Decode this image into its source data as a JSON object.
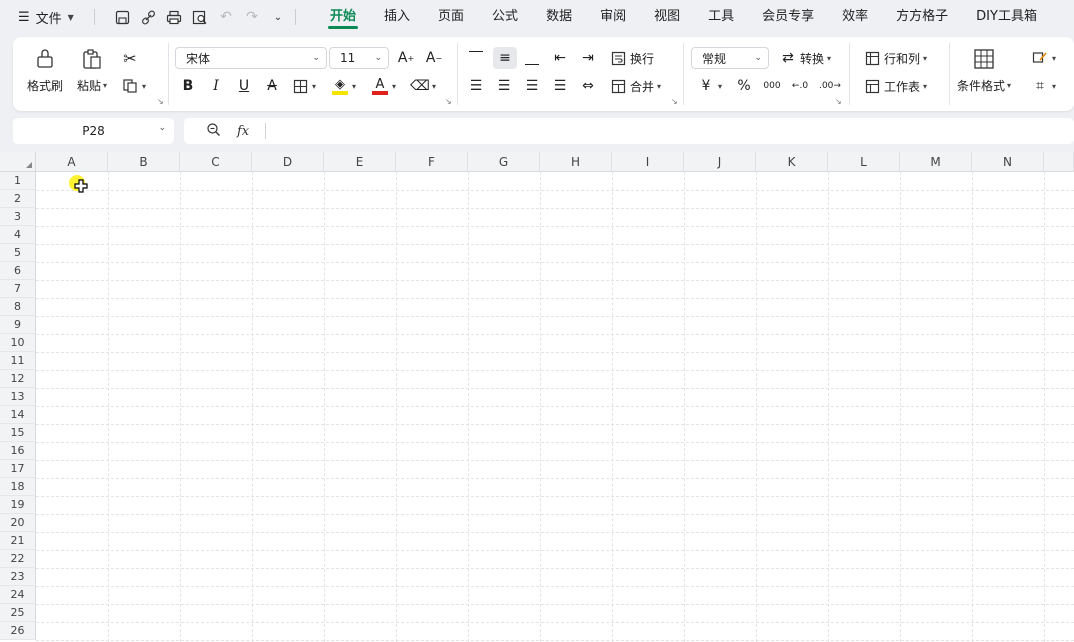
{
  "menu": {
    "file_label": "文件",
    "tabs": [
      "开始",
      "插入",
      "页面",
      "公式",
      "数据",
      "审阅",
      "视图",
      "工具",
      "会员专享",
      "效率",
      "方方格子",
      "DIY工具箱"
    ],
    "active_tab": "开始"
  },
  "ribbon": {
    "format_painter": "格式刷",
    "paste": "粘贴",
    "font_name": "宋体",
    "font_size": "11",
    "wrap": "换行",
    "merge": "合并",
    "number_format": "常规",
    "convert": "转换",
    "rows_cols": "行和列",
    "worksheet": "工作表",
    "cond_format": "条件格式",
    "currency_sym": "¥",
    "percent_sym": "%",
    "thousands_sym": "000",
    "bold": "B",
    "italic": "I",
    "underline": "U",
    "strike": "A",
    "font_color_letter": "A",
    "colors": {
      "fill": "#f5e400",
      "font": "#e0201b",
      "accent": "#0c8a55"
    }
  },
  "formula_bar": {
    "name_box": "P28",
    "fx_label": "fx",
    "content": ""
  },
  "sheet": {
    "columns": [
      "A",
      "B",
      "C",
      "D",
      "E",
      "F",
      "G",
      "H",
      "I",
      "J",
      "K",
      "L",
      "M",
      "N"
    ],
    "rows": [
      "1",
      "2",
      "3",
      "4",
      "5",
      "6",
      "7",
      "8",
      "9",
      "10",
      "11",
      "12",
      "13",
      "14",
      "15",
      "16",
      "17",
      "18",
      "19",
      "20",
      "21",
      "22",
      "23",
      "24",
      "25",
      "26"
    ]
  }
}
